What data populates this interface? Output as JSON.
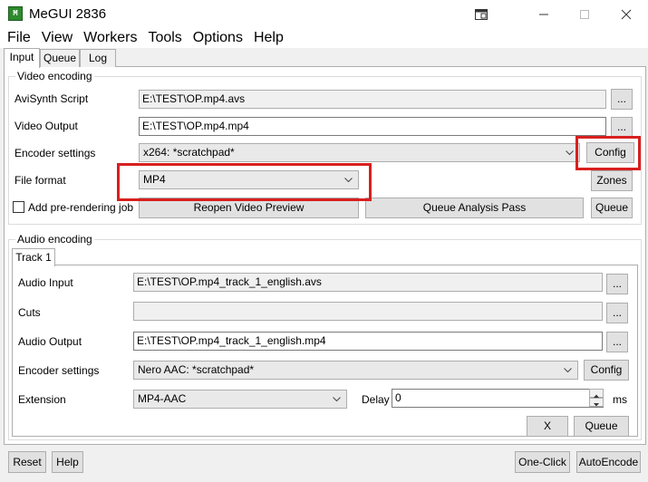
{
  "window": {
    "title": "MeGUI 2836",
    "icon_text": "M"
  },
  "menu": [
    "File",
    "View",
    "Workers",
    "Tools",
    "Options",
    "Help"
  ],
  "tabs": [
    "Input",
    "Queue",
    "Log"
  ],
  "video": {
    "group_title": "Video encoding",
    "avisynth_label": "AviSynth Script",
    "avisynth_value": "E:\\TEST\\OP.mp4.avs",
    "output_label": "Video Output",
    "output_value": "E:\\TEST\\OP.mp4.mp4",
    "encoder_label": "Encoder settings",
    "encoder_value": "x264: *scratchpad*",
    "config_label": "Config",
    "format_label": "File format",
    "format_value": "MP4",
    "zones_label": "Zones",
    "prerender_label": "Add pre-rendering job",
    "reopen_label": "Reopen Video Preview",
    "analysis_label": "Queue Analysis Pass",
    "queue_label": "Queue",
    "browse_label": "..."
  },
  "audio": {
    "group_title": "Audio encoding",
    "track_tab": "Track 1",
    "input_label": "Audio Input",
    "input_value": "E:\\TEST\\OP.mp4_track_1_english.avs",
    "cuts_label": "Cuts",
    "cuts_value": "",
    "output_label": "Audio Output",
    "output_value": "E:\\TEST\\OP.mp4_track_1_english.mp4",
    "encoder_label": "Encoder settings",
    "encoder_value": "Nero AAC: *scratchpad*",
    "config_label": "Config",
    "extension_label": "Extension",
    "extension_value": "MP4-AAC",
    "delay_label": "Delay",
    "delay_value": "0",
    "delay_unit": "ms",
    "x_label": "X",
    "queue_label": "Queue",
    "browse_label": "..."
  },
  "footer": {
    "reset_label": "Reset",
    "help_label": "Help",
    "oneclick_label": "One-Click",
    "autoencode_label": "AutoEncode"
  },
  "colors": {
    "highlight": "#d81f1f",
    "app_icon": "#2d8a2d"
  }
}
